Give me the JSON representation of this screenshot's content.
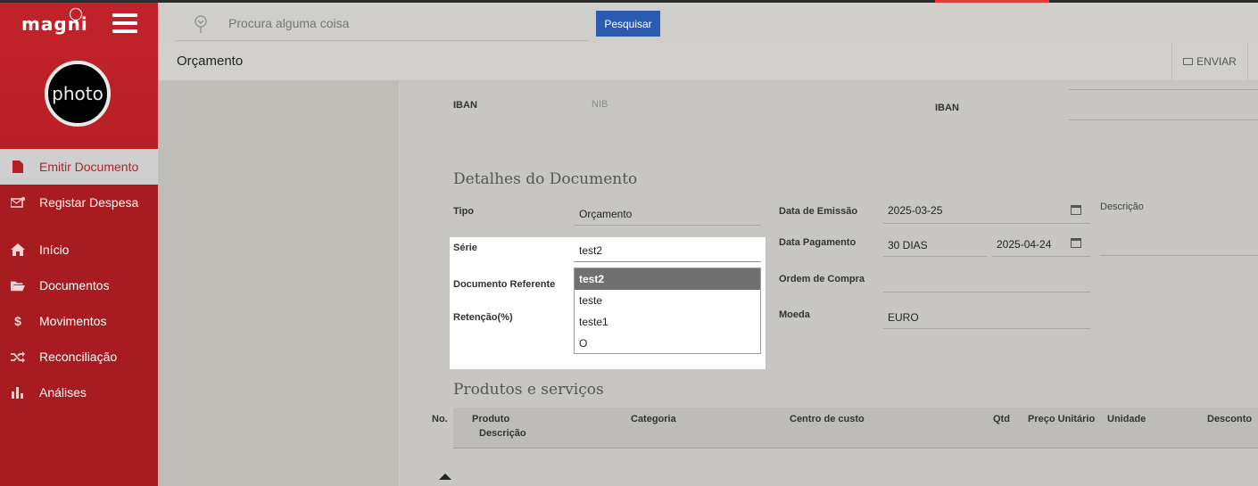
{
  "app": {
    "logo_text": "magni"
  },
  "sidebar": {
    "avatar_text": "photo",
    "items": [
      {
        "label": "Emitir Documento",
        "icon": "document-icon",
        "active": true
      },
      {
        "label": "Registar Despesa",
        "icon": "expense-mail-icon"
      },
      {
        "label": "Início",
        "icon": "home-icon"
      },
      {
        "label": "Documentos",
        "icon": "folder-icon"
      },
      {
        "label": "Movimentos",
        "icon": "dollar-icon"
      },
      {
        "label": "Reconciliação",
        "icon": "shuffle-icon"
      },
      {
        "label": "Análises",
        "icon": "bar-chart-icon"
      }
    ]
  },
  "search": {
    "placeholder": "Procura alguma coisa",
    "button_label": "Pesquisar"
  },
  "header": {
    "title": "Orçamento",
    "send_label": "ENVIAR"
  },
  "bank": {
    "iban_label": "IBAN",
    "nib_placeholder": "NIB",
    "iban_label2": "IBAN"
  },
  "document": {
    "section_title": "Detalhes do Documento",
    "tipo_label": "Tipo",
    "tipo_value": "Orçamento",
    "serie_label": "Série",
    "serie_value": "test2",
    "referente_label": "Documento Referente",
    "retencao_label": "Retenção(%)",
    "emissao_label": "Data de Emissão",
    "emissao_value": "2025-03-25",
    "pagamento_label": "Data Pagamento",
    "pagamento_value": "30 DIAS",
    "pagamento_date": "2025-04-24",
    "ordem_label": "Ordem de Compra",
    "moeda_label": "Moeda",
    "moeda_value": "EURO",
    "descricao_label": "Descrição"
  },
  "serie_options": [
    "test2",
    "teste",
    "teste1",
    "O"
  ],
  "products": {
    "section_title": "Produtos e serviços",
    "columns": [
      "No.",
      "Produto",
      "Descrição",
      "Categoria",
      "Centro de custo",
      "Qtd",
      "Preço Unitário",
      "Unidade",
      "Desconto"
    ]
  },
  "colors": {
    "brand_red": "#b91f26",
    "button_blue": "#2a5bb0"
  }
}
